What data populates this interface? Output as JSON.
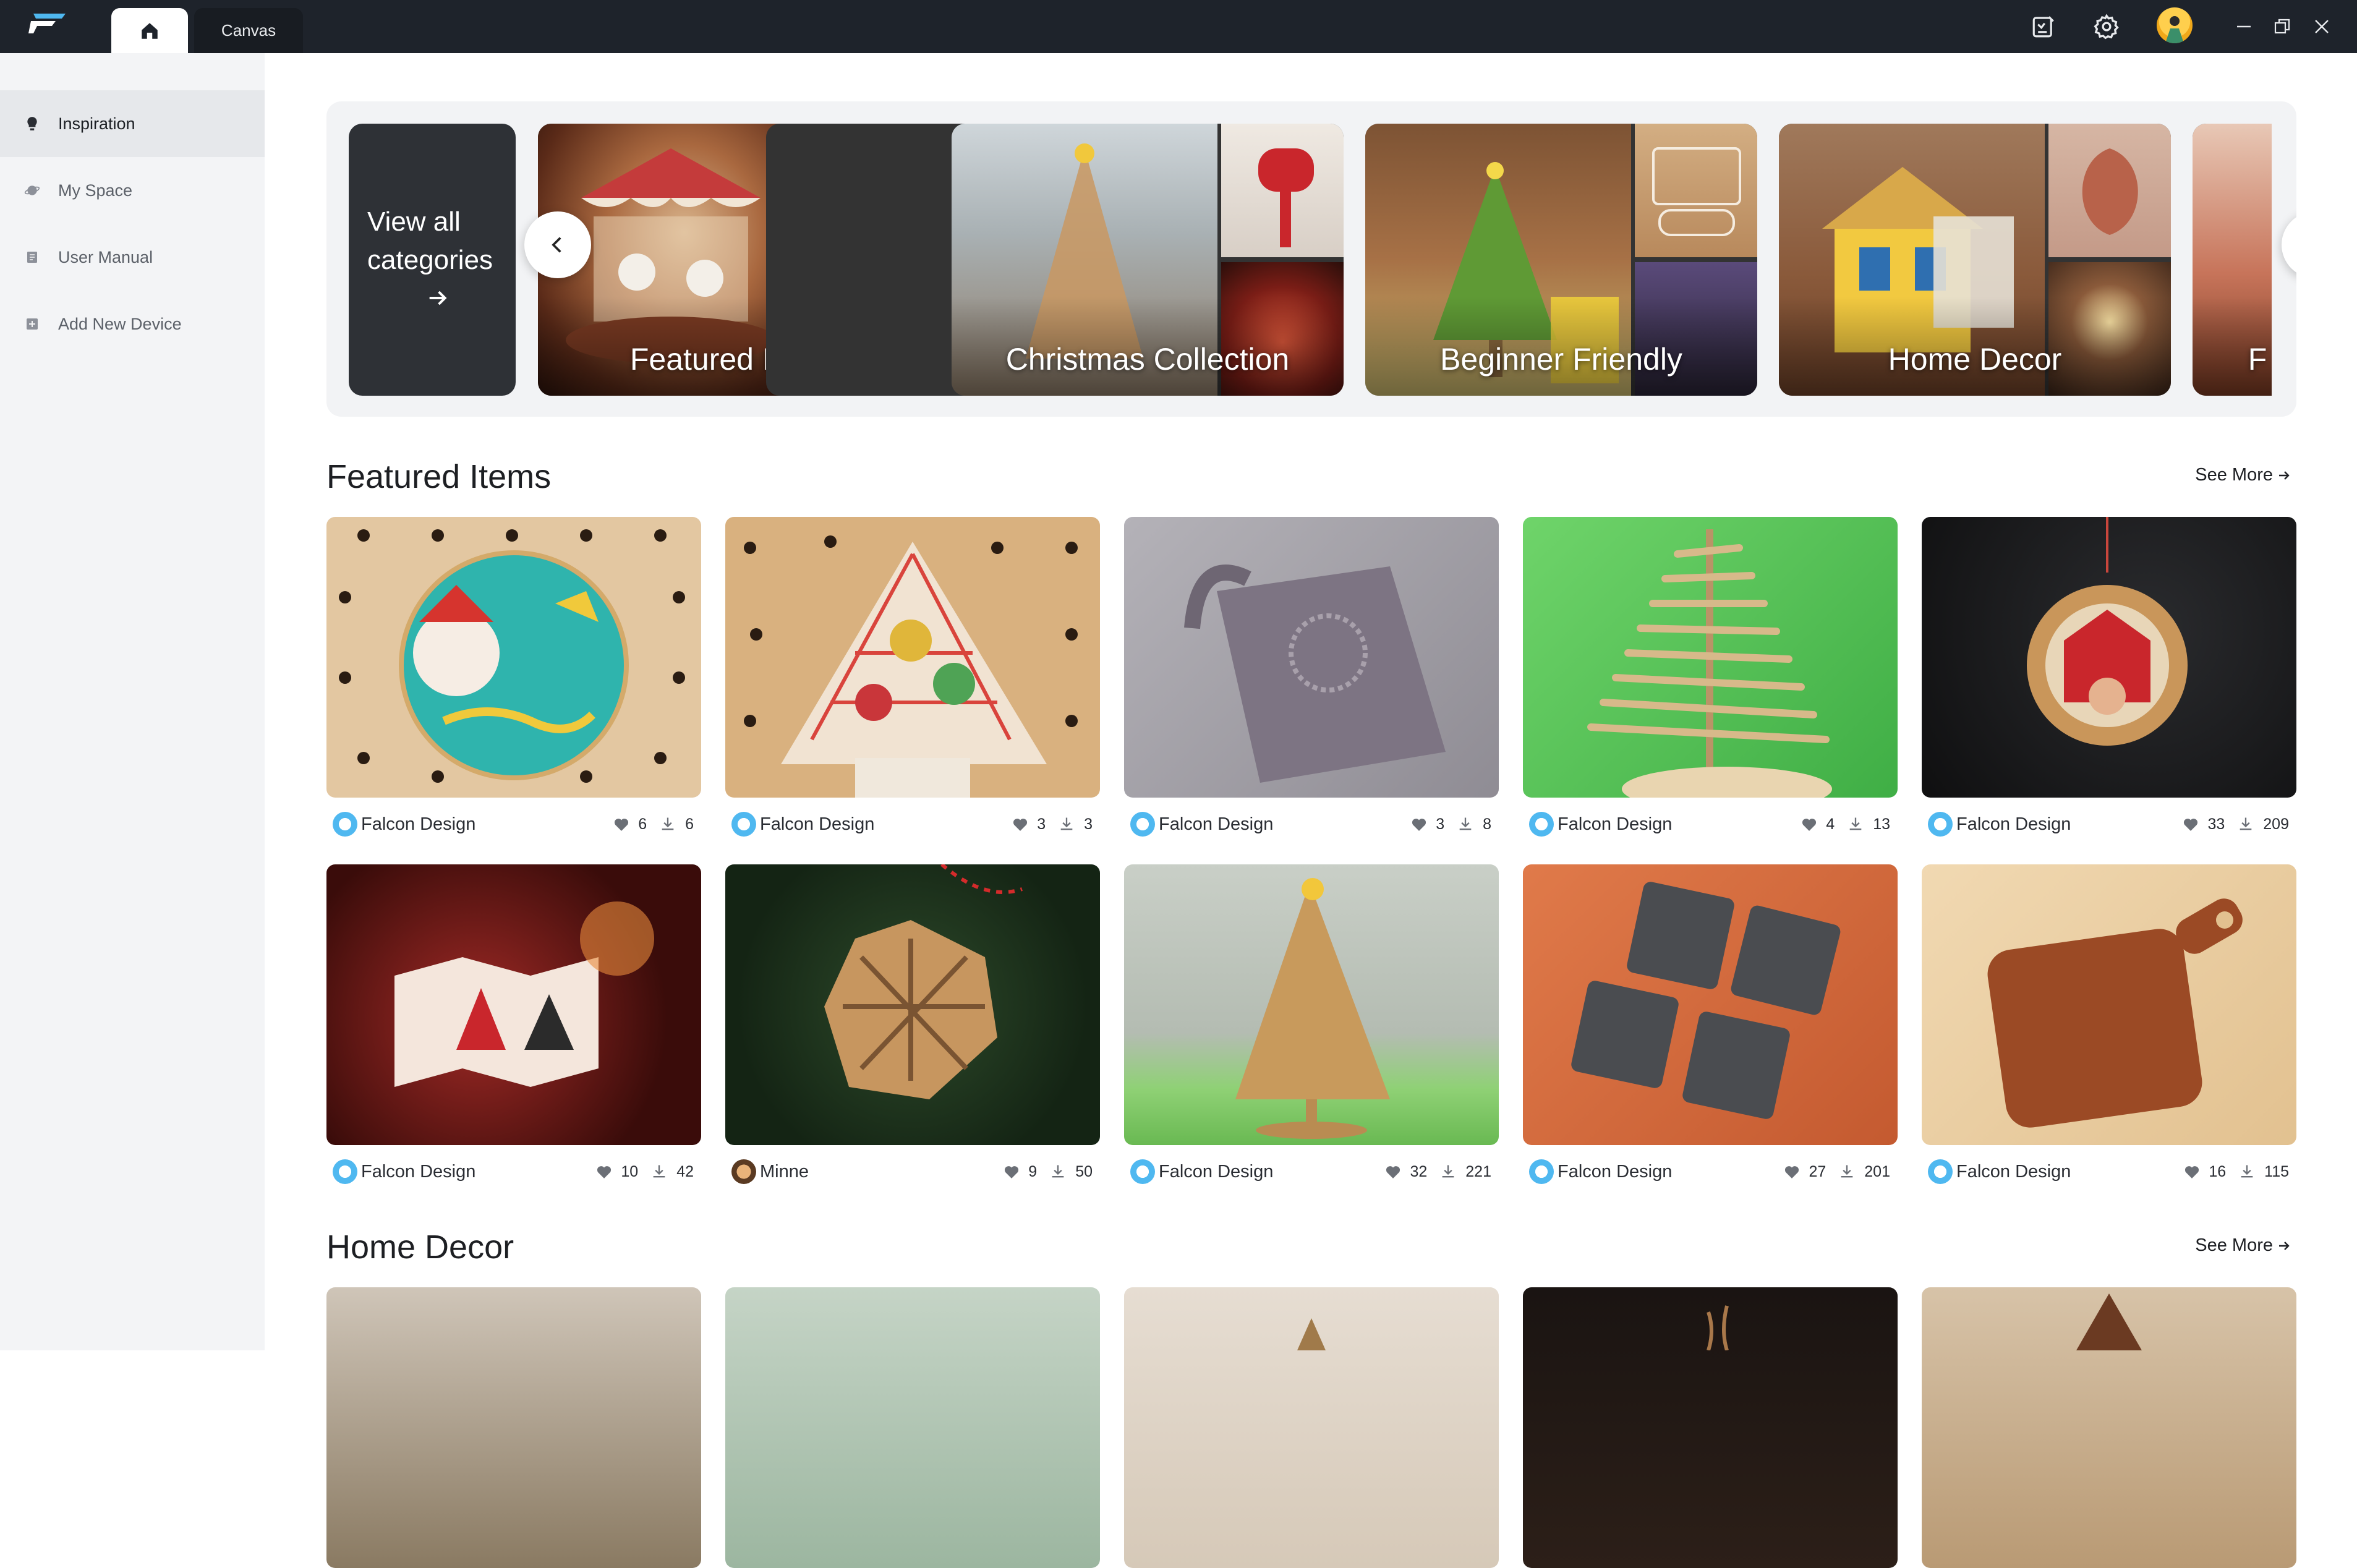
{
  "titlebar": {
    "tabs": [
      {
        "label": "",
        "icon": "home-icon"
      },
      {
        "label": "Canvas"
      }
    ],
    "icons": [
      "notes-icon",
      "gear-icon",
      "avatar",
      "minimize-icon",
      "restore-icon",
      "close-icon"
    ]
  },
  "sidebar": {
    "items": [
      {
        "label": "Inspiration",
        "icon": "lightbulb-icon",
        "active": true
      },
      {
        "label": "My Space",
        "icon": "planet-icon"
      },
      {
        "label": "User Manual",
        "icon": "book-icon"
      },
      {
        "label": "Add New Device",
        "icon": "add-device-icon"
      }
    ]
  },
  "carousel": {
    "view_all": "View all categories",
    "categories": [
      {
        "label": "Featured Items"
      },
      {
        "label": "Christmas Collection"
      },
      {
        "label": "Beginner Friendly"
      },
      {
        "label": "Home Decor"
      },
      {
        "label": "F"
      }
    ]
  },
  "featured": {
    "title": "Featured Items",
    "see_more": "See More",
    "items": [
      {
        "author": "Falcon Design",
        "likes": "6",
        "downloads": "6"
      },
      {
        "author": "Falcon Design",
        "likes": "3",
        "downloads": "3"
      },
      {
        "author": "Falcon Design",
        "likes": "3",
        "downloads": "8"
      },
      {
        "author": "Falcon Design",
        "likes": "4",
        "downloads": "13"
      },
      {
        "author": "Falcon Design",
        "likes": "33",
        "downloads": "209"
      },
      {
        "author": "Falcon Design",
        "likes": "10",
        "downloads": "42"
      },
      {
        "author": "Minne",
        "likes": "9",
        "downloads": "50"
      },
      {
        "author": "Falcon Design",
        "likes": "32",
        "downloads": "221"
      },
      {
        "author": "Falcon Design",
        "likes": "27",
        "downloads": "201"
      },
      {
        "author": "Falcon Design",
        "likes": "16",
        "downloads": "115"
      }
    ]
  },
  "home_decor": {
    "title": "Home Decor",
    "see_more": "See More"
  },
  "colors": {
    "titlebar": "#1e232b",
    "sidebar": "#f3f4f6",
    "sidebar_active": "#e6e8eb",
    "carousel_bg": "#f2f3f5",
    "view_all_bg": "#2e3136"
  }
}
